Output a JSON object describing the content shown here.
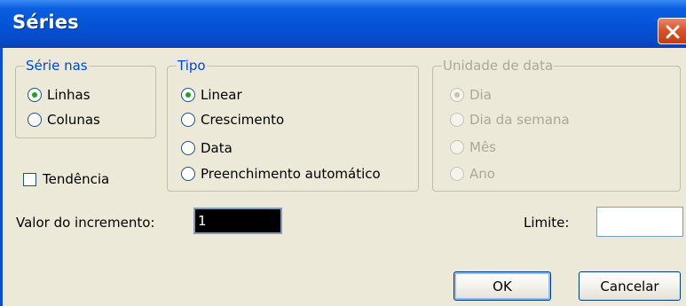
{
  "window": {
    "title": "Séries"
  },
  "serie_nas": {
    "legend": "Série nas",
    "options": [
      {
        "label": "Linhas",
        "selected": true
      },
      {
        "label": "Colunas",
        "selected": false
      }
    ]
  },
  "tipo": {
    "legend": "Tipo",
    "options": [
      {
        "label": "Linear",
        "selected": true
      },
      {
        "label": "Crescimento",
        "selected": false
      },
      {
        "label": "Data",
        "selected": false
      },
      {
        "label": "Preenchimento automático",
        "selected": false
      }
    ]
  },
  "unidade_de_data": {
    "legend": "Unidade de data",
    "disabled": true,
    "options": [
      {
        "label": "Dia",
        "selected": true
      },
      {
        "label": "Dia da semana",
        "selected": false
      },
      {
        "label": "Mês",
        "selected": false
      },
      {
        "label": "Ano",
        "selected": false
      }
    ]
  },
  "tendencia": {
    "label": "Tendência",
    "checked": false
  },
  "incremento": {
    "label": "Valor do incremento:",
    "value": "1"
  },
  "limite": {
    "label": "Limite:",
    "value": ""
  },
  "buttons": {
    "ok": "OK",
    "cancel": "Cancelar"
  },
  "colors": {
    "titlebar": "#0652d6",
    "face": "#ece9d8",
    "legend": "#0046d5",
    "radio_dot": "#21a121"
  }
}
